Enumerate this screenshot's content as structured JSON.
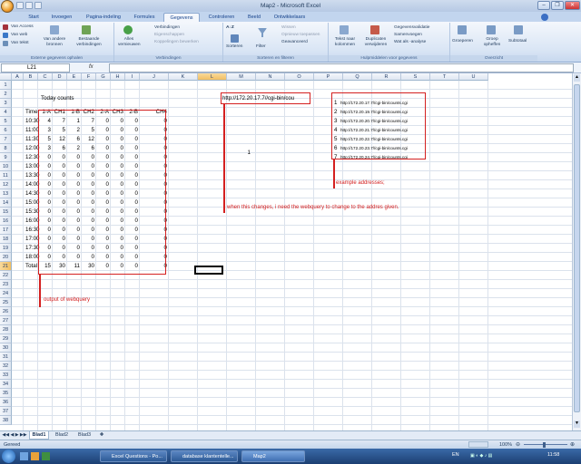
{
  "window": {
    "title": "Map2 - Microsoft Excel"
  },
  "tabs": [
    "Start",
    "Invoegen",
    "Pagina-indeling",
    "Formules",
    "Gegevens",
    "Controleren",
    "Beeld",
    "Ontwikkelaars"
  ],
  "ribbon": {
    "ext": {
      "access": "Van Access",
      "web": "Van web",
      "text": "Van tekst",
      "other": "Van andere bronnen",
      "existing": "Bestaande verbindingen",
      "group": "Externe gegevens ophalen"
    },
    "conn": {
      "refresh": "Alles vernieuwen",
      "connections": "Verbindingen",
      "props": "Eigenschappen",
      "links": "Koppelingen bewerken",
      "group": "Verbindingen"
    },
    "sort": {
      "sort": "Sorteren",
      "filter": "Filter",
      "clear": "Wissen",
      "reapply": "Opnieuw toepassen",
      "advanced": "Geavanceerd",
      "group": "Sorteren en filteren"
    },
    "tools": {
      "t2c": "Tekst naar kolommen",
      "dup": "Duplicaten verwijderen",
      "valid": "Gegevensvalidatie",
      "consol": "Samenvoegen",
      "whatif": "Wat als -analyse",
      "group": "Hulpmiddelen voor gegevens"
    },
    "outline": {
      "grp": "Groeperen",
      "ungrp": "Groep opheffen",
      "subtotal": "Subtotaal",
      "group": "Overzicht"
    }
  },
  "namebox": "L21",
  "fx": "fx",
  "columns": [
    "A",
    "B",
    "C",
    "D",
    "E",
    "F",
    "G",
    "H",
    "I",
    "J",
    "K",
    "L",
    "M",
    "N",
    "O",
    "P",
    "Q",
    "R",
    "S",
    "T",
    "U"
  ],
  "rows": [
    "1",
    "2",
    "3",
    "4",
    "5",
    "6",
    "7",
    "8",
    "9",
    "10",
    "11",
    "12",
    "13",
    "14",
    "15",
    "16",
    "17",
    "18",
    "19",
    "20",
    "21",
    "22",
    "23",
    "24",
    "25",
    "26",
    "27",
    "28",
    "29",
    "30",
    "31",
    "32",
    "33",
    "34",
    "35",
    "36",
    "37",
    "38"
  ],
  "title": "Today counts",
  "table_headers": [
    "Time",
    "1-A",
    "CH1",
    "1-B",
    "CH2",
    "2-A",
    "CH3",
    "2-B",
    "CH4"
  ],
  "table_rows": [
    [
      "10:30",
      "4",
      "7",
      "1",
      "7",
      "0",
      "0",
      "0",
      "0"
    ],
    [
      "11:00",
      "3",
      "5",
      "2",
      "5",
      "0",
      "0",
      "0",
      "0"
    ],
    [
      "11:30",
      "5",
      "12",
      "6",
      "12",
      "0",
      "0",
      "0",
      "0"
    ],
    [
      "12:00",
      "3",
      "6",
      "2",
      "6",
      "0",
      "0",
      "0",
      "0"
    ],
    [
      "12:30",
      "0",
      "0",
      "0",
      "0",
      "0",
      "0",
      "0",
      "0"
    ],
    [
      "13:00",
      "0",
      "0",
      "0",
      "0",
      "0",
      "0",
      "0",
      "0"
    ],
    [
      "13:30",
      "0",
      "0",
      "0",
      "0",
      "0",
      "0",
      "0",
      "0"
    ],
    [
      "14:00",
      "0",
      "0",
      "0",
      "0",
      "0",
      "0",
      "0",
      "0"
    ],
    [
      "14:30",
      "0",
      "0",
      "0",
      "0",
      "0",
      "0",
      "0",
      "0"
    ],
    [
      "15:00",
      "0",
      "0",
      "0",
      "0",
      "0",
      "0",
      "0",
      "0"
    ],
    [
      "15:30",
      "0",
      "0",
      "0",
      "0",
      "0",
      "0",
      "0",
      "0"
    ],
    [
      "16:00",
      "0",
      "0",
      "0",
      "0",
      "0",
      "0",
      "0",
      "0"
    ],
    [
      "16:30",
      "0",
      "0",
      "0",
      "0",
      "0",
      "0",
      "0",
      "0"
    ],
    [
      "17:00",
      "0",
      "0",
      "0",
      "0",
      "0",
      "0",
      "0",
      "0"
    ],
    [
      "17:30",
      "0",
      "0",
      "0",
      "0",
      "0",
      "0",
      "0",
      "0"
    ],
    [
      "18:00",
      "0",
      "0",
      "0",
      "0",
      "0",
      "0",
      "0",
      "0"
    ],
    [
      "Total",
      "15",
      "30",
      "11",
      "30",
      "0",
      "0",
      "0",
      "0"
    ]
  ],
  "url_cell": "http://172.20.17.7//cgi-bin/cou",
  "n8_value": "1",
  "addresses": [
    {
      "n": "1",
      "url": "http://172.20.17.7//cgi-bin/counts.cgi"
    },
    {
      "n": "2",
      "url": "http://172.20.19.7//cgi-bin/counts.cgi"
    },
    {
      "n": "3",
      "url": "http://172.20.20.7//cgi-bin/counts.cgi"
    },
    {
      "n": "4",
      "url": "http://172.20.21.7//cgi-bin/counts.cgi"
    },
    {
      "n": "5",
      "url": "http://172.20.22.7//cgi-bin/counts.cgi"
    },
    {
      "n": "6",
      "url": "http://172.20.23.7//cgi-bin/counts.cgi"
    },
    {
      "n": "7",
      "url": "http://172.20.24.7//cgi-bin/counts.cgi"
    }
  ],
  "notes": {
    "examples": "example addresses;",
    "change": "when this changes, i need the webquery to change to the addres given.",
    "output": "output of webquery"
  },
  "sheets": [
    "Blad1",
    "Blad2",
    "Blad3"
  ],
  "status": {
    "ready": "Gereed",
    "zoom": "100%"
  },
  "taskbar": {
    "items": [
      "Excel Questions - Po...",
      "database klantentelle...",
      "Map2"
    ],
    "lang": "EN",
    "time": "11:58"
  },
  "colors": {
    "annotation": "#d42020",
    "accent": "#15428b"
  }
}
